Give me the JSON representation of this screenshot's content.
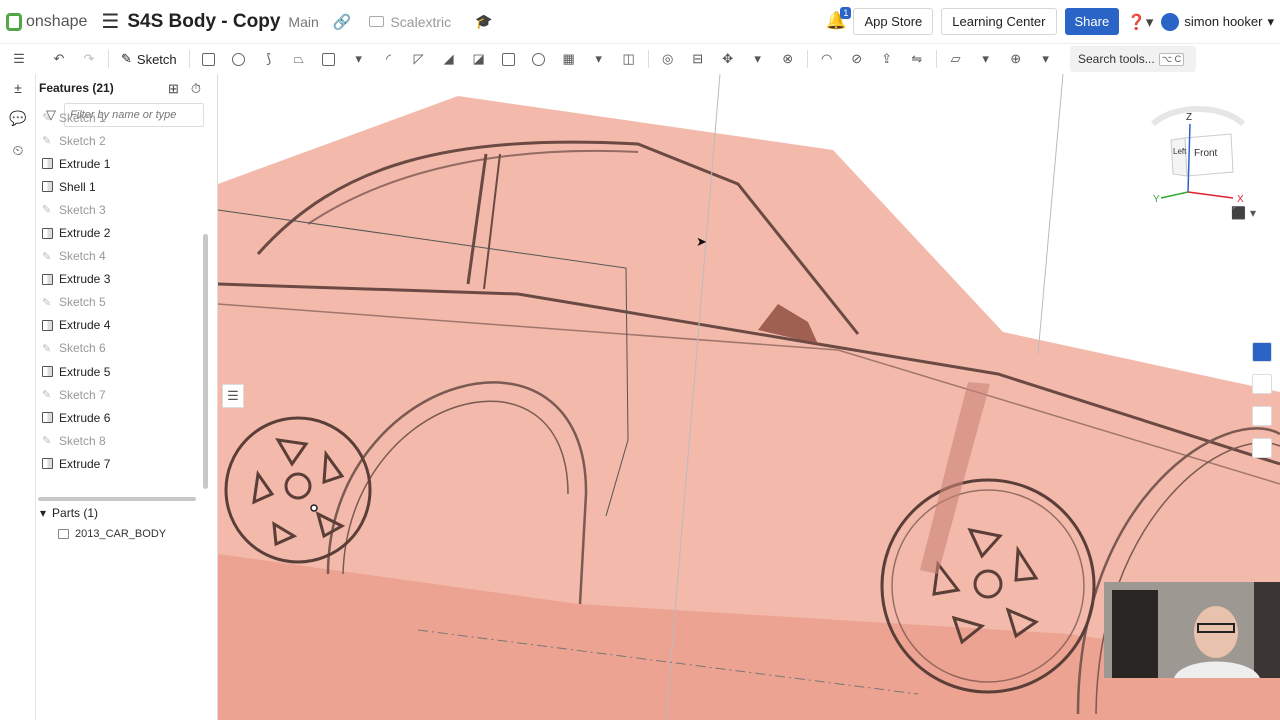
{
  "app": {
    "name": "onshape"
  },
  "document": {
    "title": "S4S Body - Copy",
    "branch": "Main",
    "folder": "Scalextric"
  },
  "topbar": {
    "notifications_count": "1",
    "app_store": "App Store",
    "learning_center": "Learning Center",
    "share": "Share",
    "user": "simon hooker"
  },
  "toolbar": {
    "sketch_label": "Sketch",
    "search_placeholder": "Search tools...",
    "search_shortcut": "⌥ C"
  },
  "features": {
    "header": "Features (21)",
    "filter_placeholder": "Filter by name or type",
    "items": [
      {
        "label": "Sketch 1",
        "kind": "sketch"
      },
      {
        "label": "Sketch 2",
        "kind": "sketch"
      },
      {
        "label": "Extrude 1",
        "kind": "feature"
      },
      {
        "label": "Shell 1",
        "kind": "feature"
      },
      {
        "label": "Sketch 3",
        "kind": "sketch"
      },
      {
        "label": "Extrude 2",
        "kind": "feature"
      },
      {
        "label": "Sketch 4",
        "kind": "sketch"
      },
      {
        "label": "Extrude 3",
        "kind": "feature"
      },
      {
        "label": "Sketch 5",
        "kind": "sketch"
      },
      {
        "label": "Extrude 4",
        "kind": "feature"
      },
      {
        "label": "Sketch 6",
        "kind": "sketch"
      },
      {
        "label": "Extrude 5",
        "kind": "feature"
      },
      {
        "label": "Sketch 7",
        "kind": "sketch"
      },
      {
        "label": "Extrude 6",
        "kind": "feature"
      },
      {
        "label": "Sketch 8",
        "kind": "sketch"
      },
      {
        "label": "Extrude 7",
        "kind": "feature"
      }
    ]
  },
  "parts": {
    "header": "Parts (1)",
    "items": [
      {
        "label": "2013_CAR_BODY"
      }
    ]
  },
  "viewcube": {
    "top": "Z",
    "front": "Front",
    "left": "Left",
    "x": "X",
    "y": "Y"
  },
  "colors": {
    "accent": "#2a64c6",
    "body": "#f2b5a6",
    "logo": "#53a548"
  }
}
